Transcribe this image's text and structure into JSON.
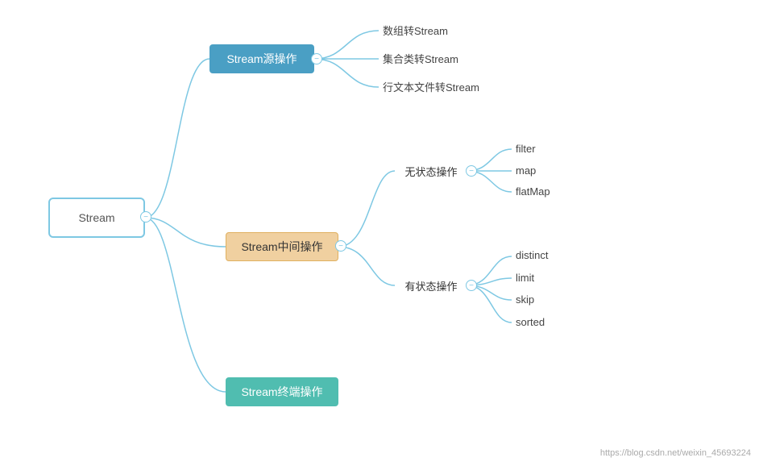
{
  "nodes": {
    "stream": {
      "label": "Stream"
    },
    "source": {
      "label": "Stream源操作"
    },
    "middle": {
      "label": "Stream中间操作"
    },
    "terminal": {
      "label": "Stream终端操作"
    },
    "stateless": {
      "label": "无状态操作"
    },
    "stateful": {
      "label": "有状态操作"
    }
  },
  "source_leaves": [
    "数组转Stream",
    "集合类转Stream",
    "行文本文件转Stream"
  ],
  "stateless_leaves": [
    "filter",
    "map",
    "flatMap"
  ],
  "stateful_leaves": [
    "distinct",
    "limit",
    "skip",
    "sorted"
  ],
  "watermark": "https://blog.csdn.net/weixin_45693224",
  "colors": {
    "line": "#7ec8e3",
    "source_bg": "#4a9fc4",
    "middle_bg": "#f0d0a0",
    "terminal_bg": "#50bdb0"
  }
}
